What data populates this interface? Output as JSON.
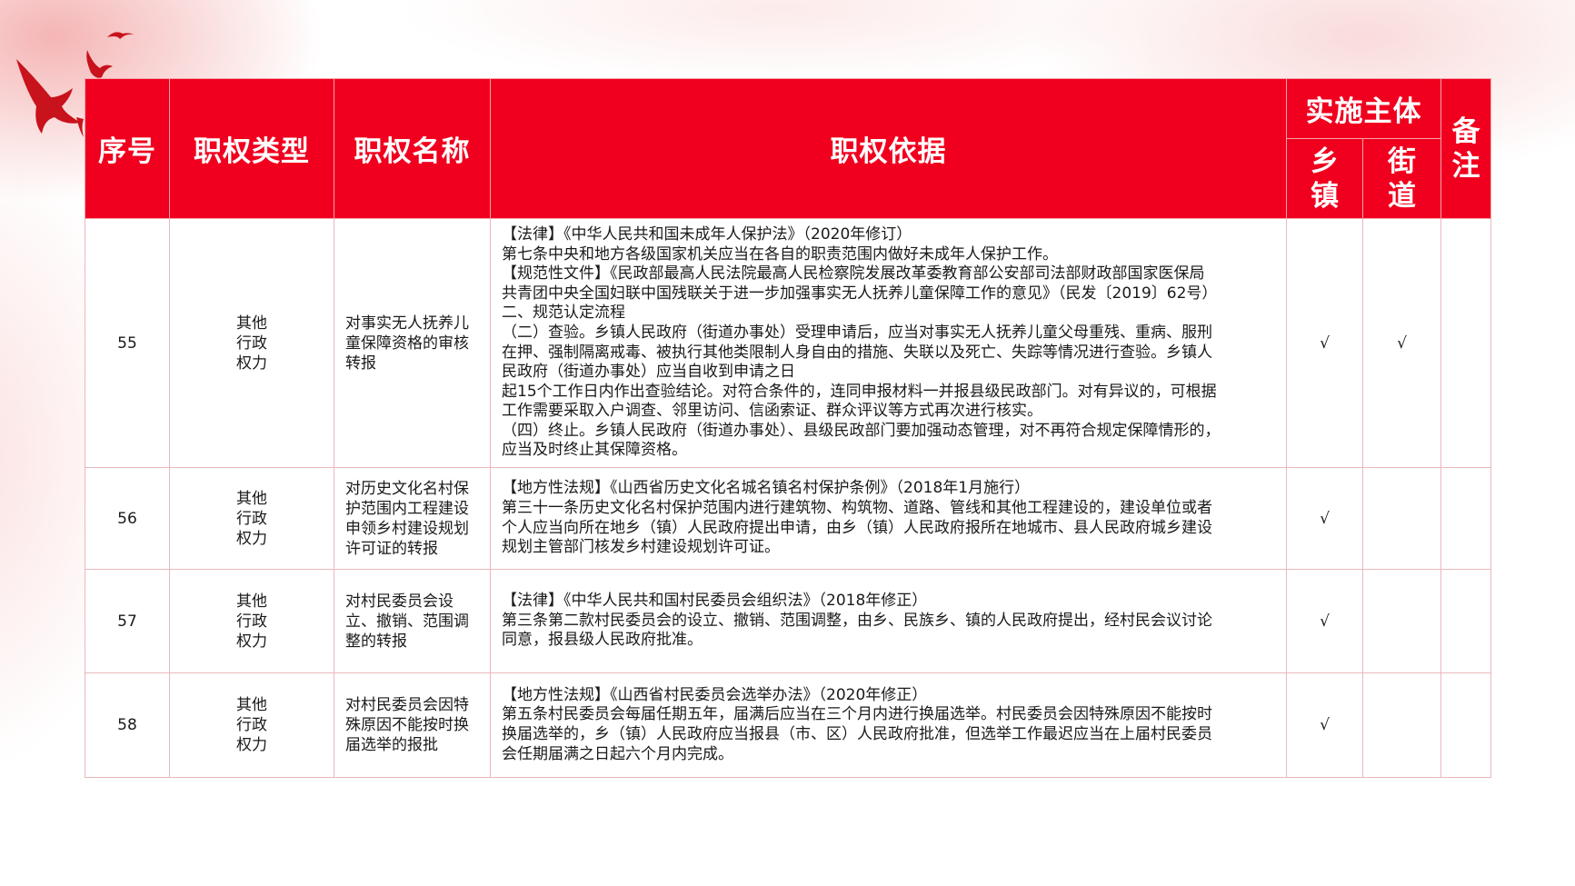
{
  "header": {
    "no": "序号",
    "type": "职权类型",
    "name": "职权名称",
    "basis": "职权依据",
    "subject": "实施主体",
    "township": "乡镇",
    "street": "街道",
    "note": "备注"
  },
  "rows": [
    {
      "no": "55",
      "type": "其他行政权力",
      "name": "对事实无人抚养儿童保障资格的审核转报",
      "basis": [
        "【法律】《中华人民共和国未成年人保护法》（2020年修订）",
        "第七条中央和地方各级国家机关应当在各自的职责范围内做好未成年人保护工作。",
        "【规范性文件】《民政部最高人民法院最高人民检察院发展改革委教育部公安部司法部财政部国家医保局",
        "共青团中央全国妇联中国残联关于进一步加强事实无人抚养儿童保障工作的意见》（民发〔2019〕62号）",
        "二、规范认定流程",
        "（二）查验。乡镇人民政府（街道办事处）受理申请后，应当对事实无人抚养儿童父母重残、重病、服刑",
        "在押、强制隔离戒毒、被执行其他类限制人身自由的措施、失联以及死亡、失踪等情况进行查验。乡镇人",
        "民政府（街道办事处）应当自收到申请之日",
        "起15个工作日内作出查验结论。对符合条件的，连同申报材料一并报县级民政部门。对有异议的，可根据",
        "工作需要采取入户调查、邻里访问、信函索证、群众评议等方式再次进行核实。",
        "（四）终止。乡镇人民政府（街道办事处）、县级民政部门要加强动态管理，对不再符合规定保障情形的，",
        "应当及时终止其保障资格。"
      ],
      "township": "√",
      "street": "√",
      "note": ""
    },
    {
      "no": "56",
      "type": "其他行政权力",
      "name": "对历史文化名村保护范围内工程建设申领乡村建设规划许可证的转报",
      "basis": [
        "【地方性法规】《山西省历史文化名城名镇名村保护条例》（2018年1月施行）",
        "第三十一条历史文化名村保护范围内进行建筑物、构筑物、道路、管线和其他工程建设的，建设单位或者",
        "个人应当向所在地乡（镇）人民政府提出申请，由乡（镇）人民政府报所在地城市、县人民政府城乡建设",
        "规划主管部门核发乡村建设规划许可证。"
      ],
      "township": "√",
      "street": "",
      "note": ""
    },
    {
      "no": "57",
      "type": "其他行政权力",
      "name": "对村民委员会设立、撤销、范围调整的转报",
      "basis": [
        "【法律】《中华人民共和国村民委员会组织法》（2018年修正）",
        "第三条第二款村民委员会的设立、撤销、范围调整，由乡、民族乡、镇的人民政府提出，经村民会议讨论",
        "同意，报县级人民政府批准。"
      ],
      "township": "√",
      "street": "",
      "note": ""
    },
    {
      "no": "58",
      "type": "其他行政权力",
      "name": "对村民委员会因特殊原因不能按时换届选举的报批",
      "basis": [
        "【地方性法规】《山西省村民委员会选举办法》（2020年修正）",
        "第五条村民委员会每届任期五年，届满后应当在三个月内进行换届选举。村民委员会因特殊原因不能按时",
        "换届选举的，乡（镇）人民政府应当报县（市、区）人民政府批准，但选举工作最迟应当在上届村民委员",
        "会任期届满之日起六个月内完成。"
      ],
      "township": "√",
      "street": "",
      "note": ""
    }
  ],
  "colors": {
    "header_bg": "#f0001e",
    "header_text": "#ffffff",
    "border": "#e9b8bd"
  },
  "icons": [
    "flying-birds-icon"
  ]
}
